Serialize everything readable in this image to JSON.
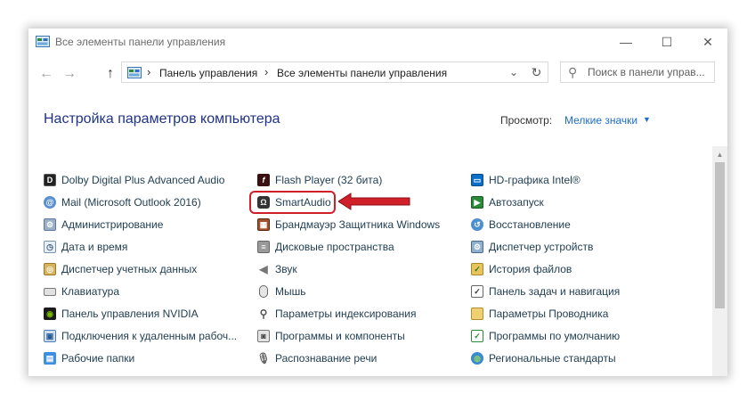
{
  "window": {
    "title": "Все элементы панели управления",
    "minimize_glyph": "—",
    "maximize_glyph": "☐",
    "close_glyph": "✕"
  },
  "address_bar": {
    "back_glyph": "←",
    "forward_glyph": "→",
    "up_glyph": "↑",
    "separator": "›",
    "crumbs": [
      "Панель управления",
      "Все элементы панели управления"
    ],
    "dropdown_glyph": "⌄",
    "refresh_glyph": "↻"
  },
  "search": {
    "placeholder": "Поиск в панели управ..."
  },
  "header": {
    "title": "Настройка параметров компьютера",
    "view_label": "Просмотр:",
    "view_value": "Мелкие значки",
    "view_caret": "▼"
  },
  "colors": {
    "title_blue": "#1e3287",
    "link_blue": "#1e6ec8",
    "highlight_red": "#d11f2a"
  },
  "items": {
    "col1": [
      {
        "label": "Dolby Digital Plus Advanced Audio",
        "icon": "dolby-icon"
      },
      {
        "label": "Mail (Microsoft Outlook 2016)",
        "icon": "mail-icon"
      },
      {
        "label": "Администрирование",
        "icon": "admin-tools-icon"
      },
      {
        "label": "Дата и время",
        "icon": "clock-icon"
      },
      {
        "label": "Диспетчер учетных данных",
        "icon": "credential-vault-icon"
      },
      {
        "label": "Клавиатура",
        "icon": "keyboard-icon"
      },
      {
        "label": "Панель управления NVIDIA",
        "icon": "nvidia-icon"
      },
      {
        "label": "Подключения к удаленным рабоч...",
        "icon": "remote-connection-icon"
      },
      {
        "label": "Рабочие папки",
        "icon": "work-folders-icon"
      }
    ],
    "col2": [
      {
        "label": "Flash Player (32 бита)",
        "icon": "flash-icon"
      },
      {
        "label": "SmartAudio",
        "icon": "smartaudio-icon"
      },
      {
        "label": "Брандмауэр Защитника Windows",
        "icon": "firewall-icon"
      },
      {
        "label": "Дисковые пространства",
        "icon": "storage-spaces-icon"
      },
      {
        "label": "Звук",
        "icon": "speaker-icon"
      },
      {
        "label": "Мышь",
        "icon": "mouse-icon"
      },
      {
        "label": "Параметры индексирования",
        "icon": "indexing-icon"
      },
      {
        "label": "Программы и компоненты",
        "icon": "programs-icon"
      },
      {
        "label": "Распознавание речи",
        "icon": "microphone-icon"
      }
    ],
    "col3": [
      {
        "label": "HD-графика Intel®",
        "icon": "intel-graphics-icon"
      },
      {
        "label": "Автозапуск",
        "icon": "autoplay-icon"
      },
      {
        "label": "Восстановление",
        "icon": "recovery-icon"
      },
      {
        "label": "Диспетчер устройств",
        "icon": "device-manager-icon"
      },
      {
        "label": "История файлов",
        "icon": "file-history-icon"
      },
      {
        "label": "Панель задач и навигация",
        "icon": "taskbar-icon"
      },
      {
        "label": "Параметры Проводника",
        "icon": "explorer-options-icon"
      },
      {
        "label": "Программы по умолчанию",
        "icon": "default-programs-icon"
      },
      {
        "label": "Региональные стандарты",
        "icon": "region-icon"
      }
    ]
  },
  "scrollbar": {
    "up_glyph": "▲"
  }
}
